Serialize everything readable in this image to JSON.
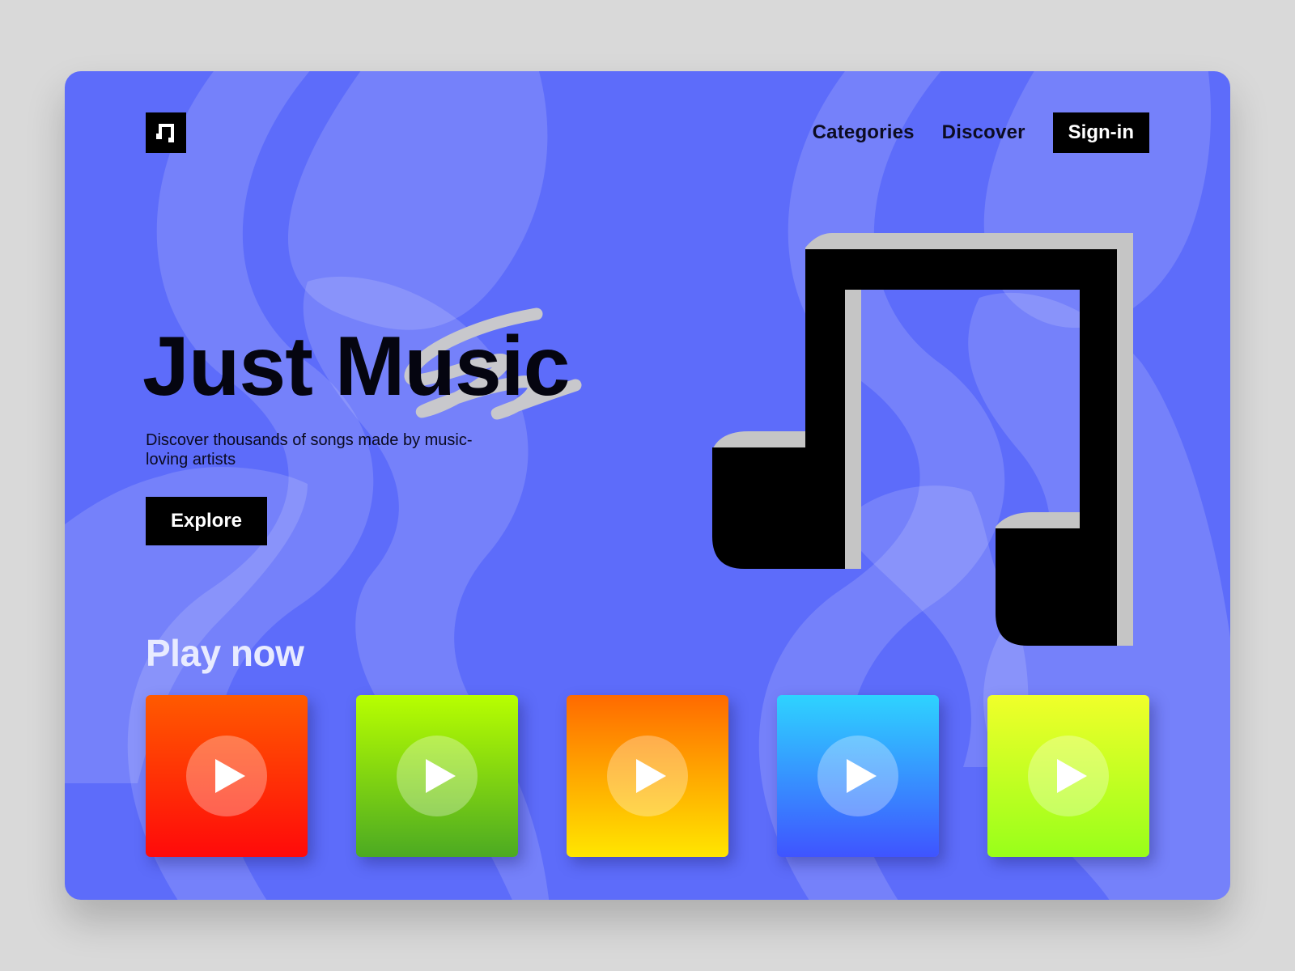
{
  "app": {
    "brand_icon": "music-note-icon",
    "accent": "#5d6cfa",
    "page_background": "#d9d9d9"
  },
  "nav": {
    "links": [
      {
        "label": "Categories"
      },
      {
        "label": "Discover"
      }
    ],
    "signin_label": "Sign-in"
  },
  "hero": {
    "title": "Just Music",
    "subtitle": "Discover thousands of songs made by music-loving artists",
    "cta_label": "Explore",
    "illustration_icon": "music-note-3d-icon"
  },
  "play_now": {
    "title": "Play now",
    "tracks": [
      {
        "icon": "play-icon",
        "gradient": [
          "#ff5a00",
          "#ff0a0a"
        ]
      },
      {
        "icon": "play-icon",
        "gradient": [
          "#b8ff00",
          "#4caa22"
        ]
      },
      {
        "icon": "play-icon",
        "gradient": [
          "#ff6a00",
          "#ffe600"
        ]
      },
      {
        "icon": "play-icon",
        "gradient": [
          "#2ed3ff",
          "#3f54ff"
        ]
      },
      {
        "icon": "play-icon",
        "gradient": [
          "#f0ff2a",
          "#98ff1a"
        ]
      }
    ]
  }
}
